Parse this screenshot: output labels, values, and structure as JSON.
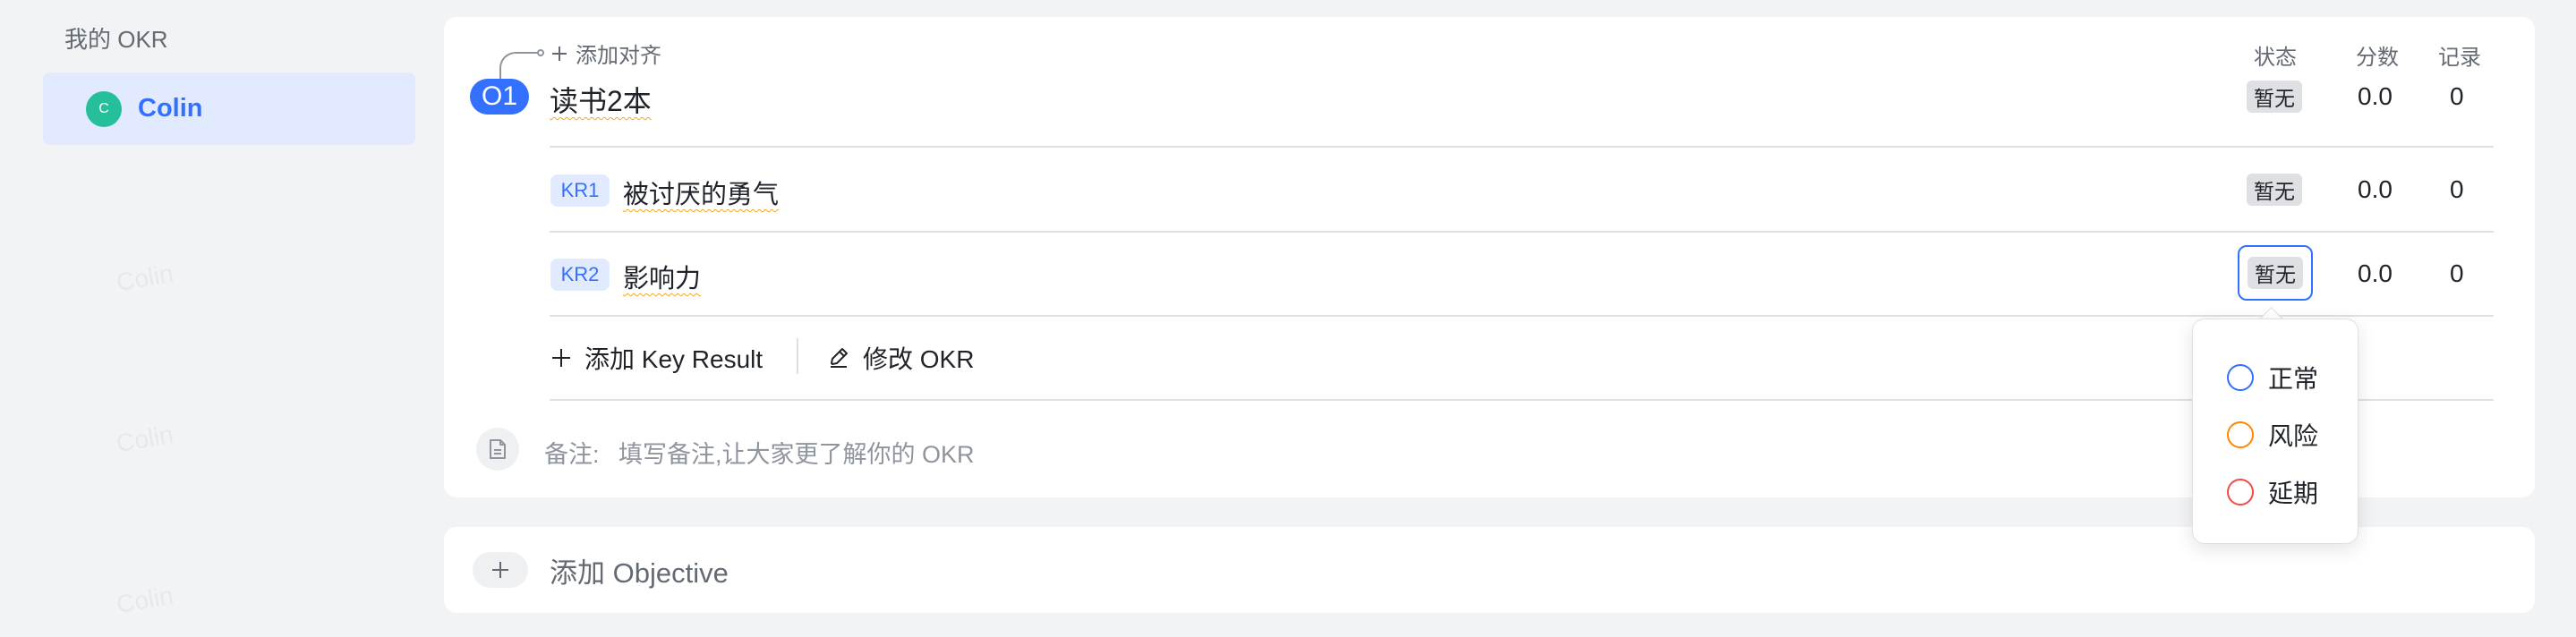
{
  "sidebar": {
    "title": "我的 OKR",
    "items": [
      {
        "avatar": "C",
        "name": "Colin"
      }
    ]
  },
  "watermark": "Colin",
  "okr": {
    "align_label": "添加对齐",
    "columns": {
      "status": "状态",
      "score": "分数",
      "record": "记录"
    },
    "objective": {
      "badge": "O1",
      "title": "读书2本",
      "status": "暂无",
      "score": "0.0",
      "record": "0"
    },
    "key_results": [
      {
        "badge": "KR1",
        "title": "被讨厌的勇气",
        "status": "暂无",
        "score": "0.0",
        "record": "0"
      },
      {
        "badge": "KR2",
        "title": "影响力",
        "status": "暂无",
        "score": "0.0",
        "record": "0"
      }
    ],
    "actions": {
      "add_kr": "添加 Key Result",
      "edit_okr": "修改 OKR"
    },
    "note": {
      "label": "备注:",
      "placeholder": "填写备注,让大家更了解你的 OKR"
    }
  },
  "add_objective": {
    "label": "添加 Objective"
  },
  "status_menu": {
    "options": [
      {
        "label": "正常",
        "color": "#3370ff"
      },
      {
        "label": "风险",
        "color": "#ff8800"
      },
      {
        "label": "延期",
        "color": "#f54a45"
      }
    ]
  }
}
